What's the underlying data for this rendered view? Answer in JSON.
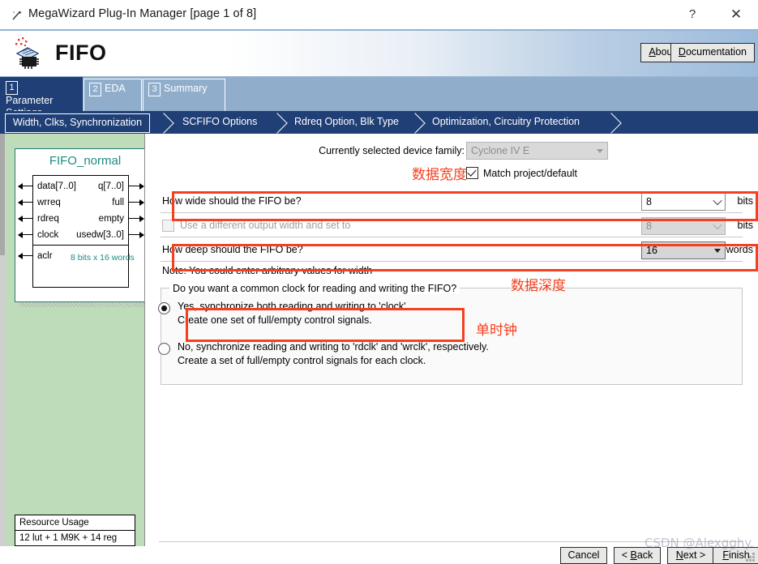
{
  "window": {
    "title": "MegaWizard Plug-In Manager [page 1 of 8]",
    "icon": "wizard-wand-icon",
    "help_label": "?",
    "close_label": "✕"
  },
  "header": {
    "product": "FIFO",
    "logo": "altera-chip-icon",
    "about_pre": "A",
    "about_post": "bout",
    "doc_pre": "D",
    "doc_post": "ocumentation"
  },
  "tabs": [
    {
      "num": "1",
      "label": "Parameter Settings",
      "active": true
    },
    {
      "num": "2",
      "label": "EDA",
      "active": false
    },
    {
      "num": "3",
      "label": "Summary",
      "active": false
    }
  ],
  "steps": [
    {
      "label": "Width, Clks, Synchronization",
      "current": true
    },
    {
      "label": "SCFIFO Options",
      "current": false
    },
    {
      "label": "Rdreq Option, Blk Type",
      "current": false
    },
    {
      "label": "Optimization, Circuitry Protection",
      "current": false
    }
  ],
  "symbol": {
    "name": "FIFO_normal",
    "inputs": [
      "data[7..0]",
      "wrreq",
      "rdreq",
      "clock",
      "aclr"
    ],
    "outputs": [
      "q[7..0]",
      "full",
      "empty",
      "usedw[3..0]"
    ],
    "size_note": "8 bits x 16 words"
  },
  "resource": {
    "title": "Resource Usage",
    "value": "12 lut + 1 M9K + 14 reg"
  },
  "main": {
    "device_family_label": "Currently selected device family:",
    "device_family_value": "Cyclone IV E",
    "match_label": "Match project/default",
    "width_question": "How wide should the FIFO be?",
    "width_value": "8",
    "width_unit": "bits",
    "out_width_label": "Use a different output width and set to",
    "out_width_value": "8",
    "out_width_unit": "bits",
    "depth_question": "How deep should the FIFO be?",
    "depth_value": "16",
    "depth_unit": "words",
    "note": "Note: You could enter arbitrary values for width",
    "clock_group_legend": "Do you want a common clock for reading and writing the FIFO?",
    "radio_yes_line1": "Yes, synchronize both reading and writing to 'clock'.",
    "radio_yes_line2": "Create one set of full/empty control signals.",
    "radio_no_line1": "No, synchronize reading and writing to 'rdclk' and 'wrclk', respectively.",
    "radio_no_line2": "Create a set of full/empty control signals for each clock."
  },
  "annotations": {
    "width": "数据宽度",
    "depth": "数据深度",
    "clock": "单时钟"
  },
  "footer": {
    "cancel": "Cancel",
    "back_pre": "< ",
    "back_key": "B",
    "back_post": "ack",
    "next_pre": "",
    "next_key": "N",
    "next_post": "ext >",
    "finish_pre": "",
    "finish_key": "F",
    "finish_post": "inish",
    "watermark": "CSDN @Alexgghy."
  },
  "colors": {
    "tab_active": "#1f3f76",
    "tab_inactive": "#90aecb",
    "accent_red": "#f4401f",
    "left_panel_green": "#bedcb9",
    "symbol_teal": "#1e8a80"
  }
}
